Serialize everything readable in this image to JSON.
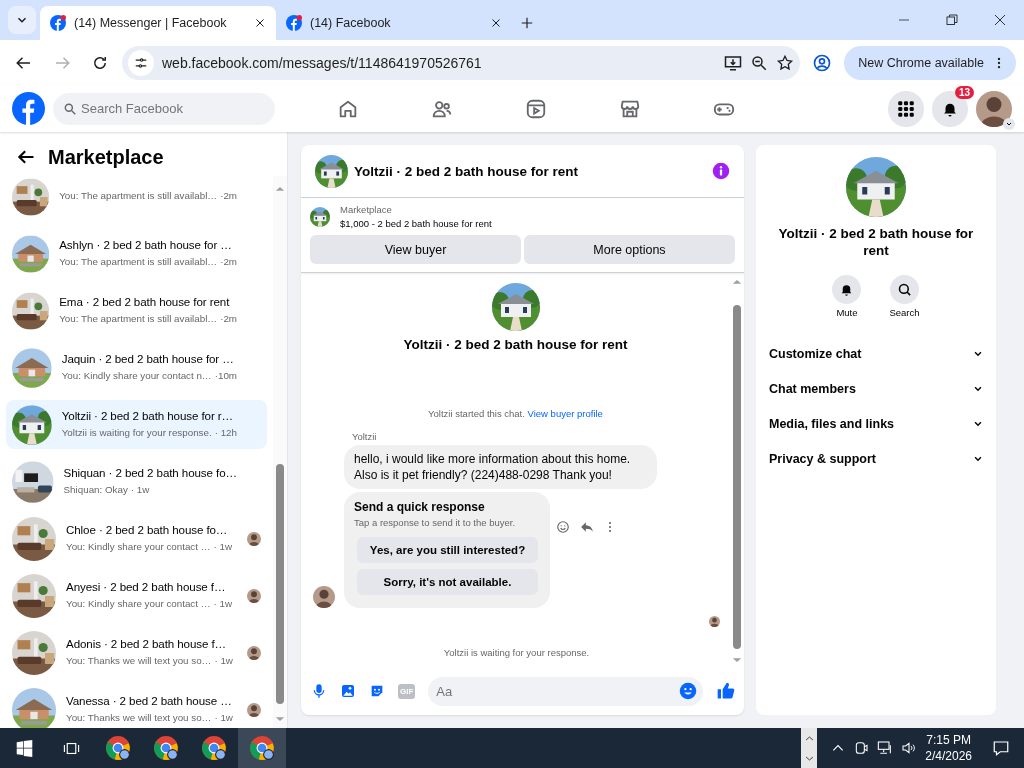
{
  "browser": {
    "tabs": [
      {
        "title": "(14) Messenger | Facebook",
        "selected": true
      },
      {
        "title": "(14) Facebook",
        "selected": false
      }
    ],
    "url": "web.facebook.com/messages/t/1148641970526761",
    "update_button": "New Chrome available"
  },
  "header": {
    "search_placeholder": "Search Facebook",
    "notification_count": "13"
  },
  "sidebar": {
    "title": "Marketplace",
    "conversations": [
      {
        "preview": "You: The apartment is still availabl…",
        "time": "·2m",
        "selected": false,
        "seen": false
      },
      {
        "title": "Ashlyn · 2 bed 2 bath house for …",
        "preview": "You: The apartment is still availabl…",
        "time": "·2m",
        "selected": false,
        "seen": false
      },
      {
        "title": "Ema · 2 bed 2 bath house for rent",
        "preview": "You: The apartment is still availabl…",
        "time": "·2m",
        "selected": false,
        "seen": false
      },
      {
        "title": "Jaquin · 2 bed 2 bath house for …",
        "preview": "You: Kindly share your contact n…",
        "time": "·10m",
        "selected": false,
        "seen": false
      },
      {
        "title": "Yoltzii · 2 bed 2 bath house for r…",
        "preview": "Yoltzii is waiting for your response.",
        "time": "· 12h",
        "selected": true,
        "seen": false
      },
      {
        "title": "Shiquan · 2 bed 2 bath house fo…",
        "preview": "Shiquan: Okay",
        "time": "· 1w",
        "selected": false,
        "seen": false
      },
      {
        "title": "Chloe · 2 bed 2 bath house fo…",
        "preview": "You: Kindly share your contact …",
        "time": "· 1w",
        "selected": false,
        "seen": true
      },
      {
        "title": "Anyesi · 2 bed 2 bath house f…",
        "preview": "You: Kindly share your contact …",
        "time": "· 1w",
        "selected": false,
        "seen": true
      },
      {
        "title": "Adonis · 2 bed 2 bath house f…",
        "preview": "You: Thanks we will text you so…",
        "time": "· 1w",
        "selected": false,
        "seen": true
      },
      {
        "title": "Vanessa · 2 bed 2 bath house …",
        "preview": "You: Thanks we will text you so…",
        "time": "· 1w",
        "selected": false,
        "seen": true
      }
    ]
  },
  "chat": {
    "title": "Yoltzii · 2 bed 2 bath house for rent",
    "listing": {
      "source": "Marketplace",
      "summary": "$1,000 - 2 bed 2 bath house for rent"
    },
    "buttons": [
      "View buyer",
      "More options"
    ],
    "intro_title": "Yoltzii · 2 bed 2 bath house for rent",
    "started_text": "Yoltzii started this chat.",
    "profile_link": "View buyer profile",
    "sender": "Yoltzii",
    "message": "hello, i would like more information about this home. Also is it pet friendly? (224)488-0298 Thank you!",
    "quick_response": {
      "title": "Send a quick response",
      "subtitle": "Tap a response to send it to the buyer.",
      "options": [
        "Yes, are you still interested?",
        "Sorry, it's not available."
      ]
    },
    "waiting_text": "Yoltzii is waiting for your response.",
    "composer": {
      "gif_label": "GIF",
      "placeholder": "Aa"
    }
  },
  "details": {
    "title": "Yoltzii · 2 bed 2 bath house for rent",
    "actions": [
      "Mute",
      "Search"
    ],
    "sections": [
      "Customize chat",
      "Chat members",
      "Media, files and links",
      "Privacy & support"
    ]
  },
  "taskbar": {
    "apps": [
      {
        "selected": false
      },
      {
        "selected": false
      },
      {
        "selected": false
      },
      {
        "selected": true
      }
    ],
    "time": "7:15 PM",
    "date": "2/4/2026"
  }
}
